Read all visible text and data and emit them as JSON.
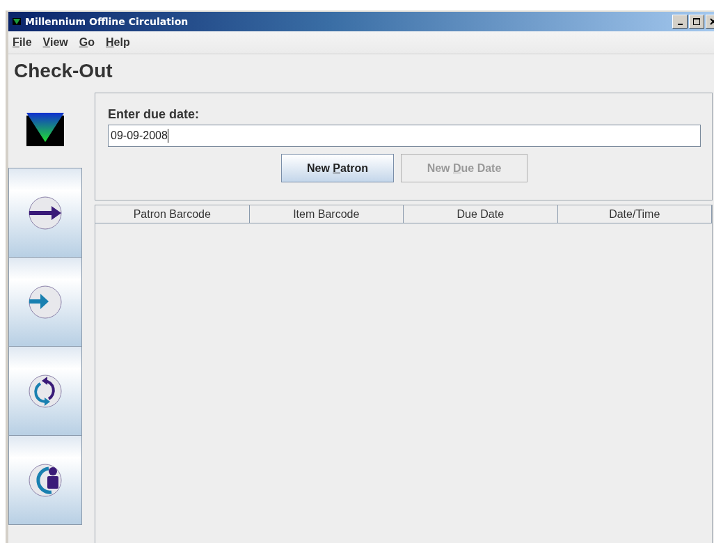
{
  "window": {
    "title": "Millennium Offline Circulation"
  },
  "menu": [
    {
      "label": [
        {
          "text": "F",
          "underlined": true
        },
        {
          "text": "ile",
          "underlined": false
        }
      ]
    },
    {
      "label": [
        {
          "text": "V",
          "underlined": true
        },
        {
          "text": "iew",
          "underlined": false
        }
      ]
    },
    {
      "label": [
        {
          "text": "G",
          "underlined": true
        },
        {
          "text": "o",
          "underlined": false
        }
      ]
    },
    {
      "label": [
        {
          "text": "H",
          "underlined": true
        },
        {
          "text": "elp",
          "underlined": false
        }
      ]
    }
  ],
  "page_title": "Check-Out",
  "sidebar": {
    "items": [
      {
        "kind": "checkout"
      },
      {
        "kind": "checkin"
      },
      {
        "kind": "renew"
      },
      {
        "kind": "patron"
      }
    ]
  },
  "due_date": {
    "label": "Enter due date:",
    "value": "09-09-2008"
  },
  "buttons": [
    {
      "label": [
        {
          "text": "New ",
          "underlined": false
        },
        {
          "text": "P",
          "underlined": true
        },
        {
          "text": "atron",
          "underlined": false
        }
      ],
      "disabled": false
    },
    {
      "label": [
        {
          "text": "New ",
          "underlined": false
        },
        {
          "text": "D",
          "underlined": true
        },
        {
          "text": "ue Date",
          "underlined": false
        }
      ],
      "disabled": true
    }
  ],
  "table": {
    "columns": [
      "Patron Barcode",
      "Item Barcode",
      "Due Date",
      "Date/Time"
    ]
  }
}
